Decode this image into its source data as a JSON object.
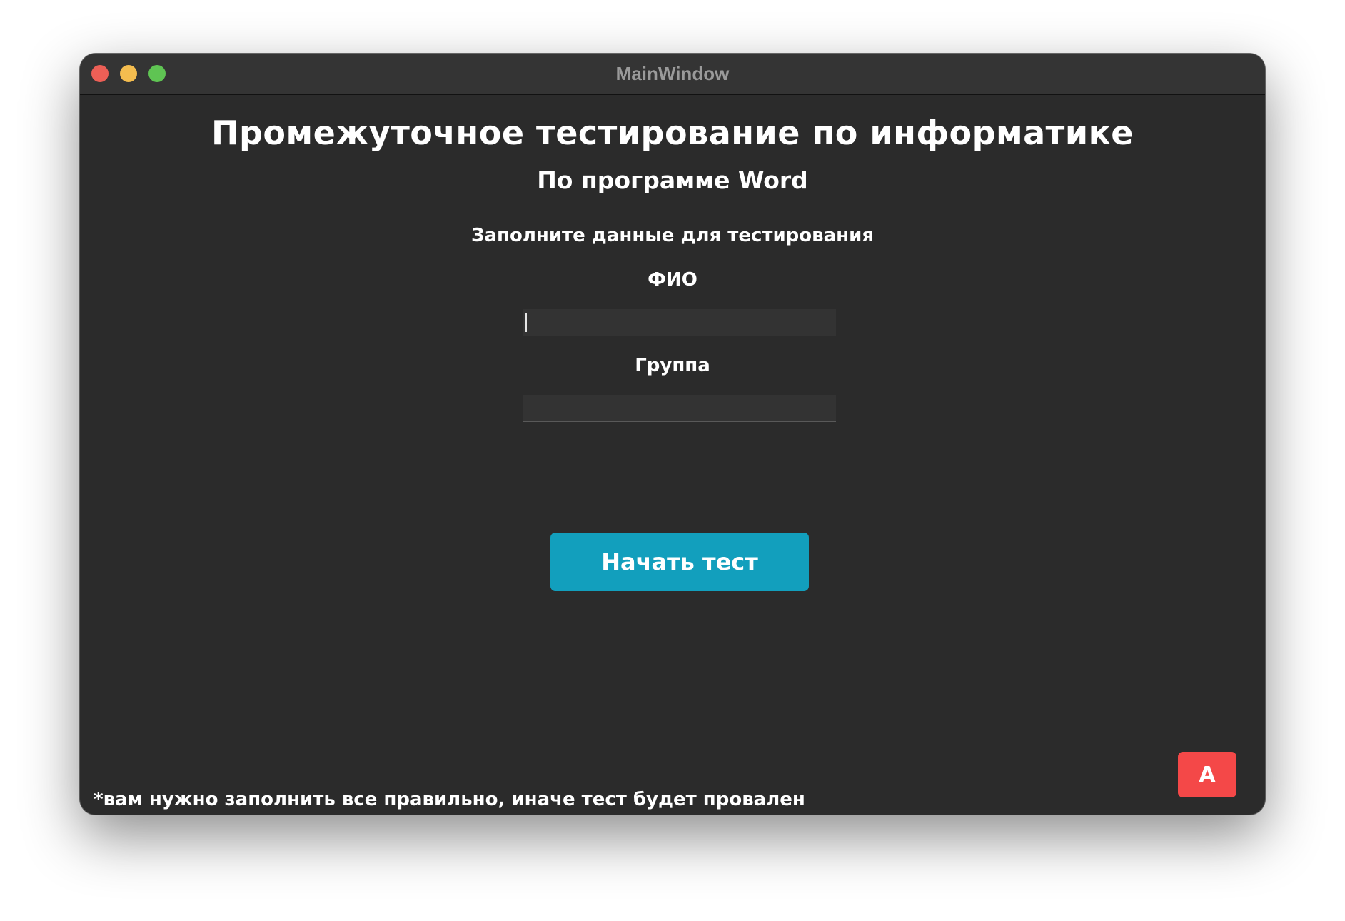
{
  "window": {
    "title": "MainWindow"
  },
  "main": {
    "title": "Промежуточное тестирование по информатике",
    "subtitle": "По программе Word",
    "instruction": "Заполните данные для тестирования",
    "fio_label": "ФИО",
    "fio_value": "",
    "group_label": "Группа",
    "group_value": "",
    "start_button": "Начать тест",
    "footnote": "*вам нужно заполнить все правильно, иначе тест будет провален",
    "corner_button": "A"
  },
  "colors": {
    "background": "#2b2b2b",
    "titlebar": "#343434",
    "start_button": "#129fbd",
    "corner_button": "#f44848",
    "text": "#ffffff"
  }
}
